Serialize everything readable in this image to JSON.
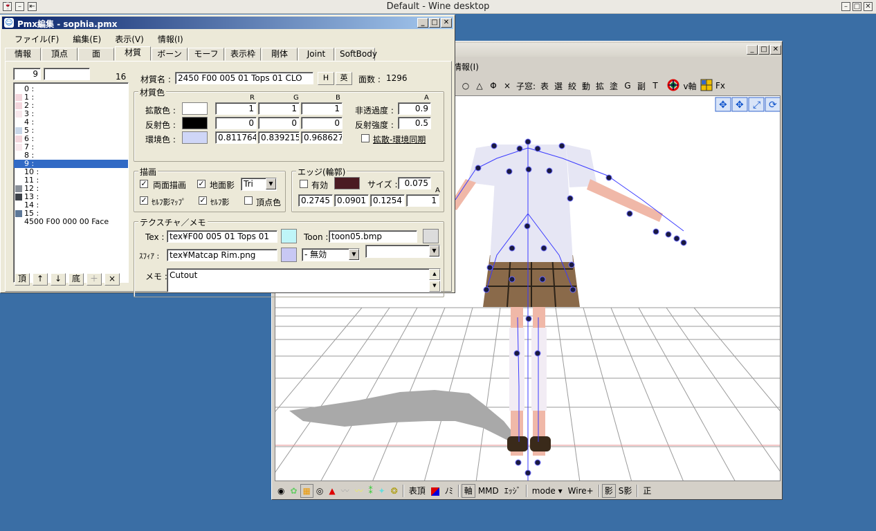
{
  "desktop": {
    "title": "Default - Wine desktop"
  },
  "viewer": {
    "menu_info": "情報(I)",
    "tools": [
      "○",
      "△",
      "Φ",
      "×",
      "子窓:",
      "表",
      "選",
      "絞",
      "動",
      "拡",
      "塗",
      "G",
      "副",
      "T",
      "v軸",
      "Fx"
    ],
    "bottom": [
      "表頂",
      "ﾉﾐ",
      "軸",
      "MMD",
      "ｴｯｼﾞ",
      "mode ▾",
      "Wire+",
      "影",
      "S影",
      "正"
    ]
  },
  "editor": {
    "title": "Pmx編集 - sophia.pmx",
    "menu": [
      "ファイル(F)",
      "編集(E)",
      "表示(V)",
      "情報(I)"
    ],
    "tabs": [
      "情報",
      "頂点",
      "面",
      "材質",
      "ボーン",
      "モーフ",
      "表示枠",
      "剛体",
      "Joint",
      "SoftBody"
    ],
    "active_tab": "材質",
    "list": {
      "index": "9",
      "search": "",
      "count": "16",
      "items": [
        {
          "label": "0 :",
          "color": "#ffffff"
        },
        {
          "label": "1 :",
          "color": "#f3d6dc"
        },
        {
          "label": "2 :",
          "color": "#f3d6dc"
        },
        {
          "label": "3 :",
          "color": "#f8e8ec"
        },
        {
          "label": "4 :",
          "color": "#ffffff"
        },
        {
          "label": "5 :",
          "color": "#c9d7e8"
        },
        {
          "label": "6 :",
          "color": "#f3d6dc"
        },
        {
          "label": "7 :",
          "color": "#f8e8ec"
        },
        {
          "label": "8 :",
          "color": "#ffffff"
        },
        {
          "label": "9 :",
          "color": "#316ac5"
        },
        {
          "label": "10 :",
          "color": "#ffffff"
        },
        {
          "label": "11 :",
          "color": "#ffffff"
        },
        {
          "label": "12 :",
          "color": "#8a9099"
        },
        {
          "label": "13 :",
          "color": "#3c4148"
        },
        {
          "label": "14 :",
          "color": "#ffffff"
        },
        {
          "label": "15 :",
          "color": "#5d7898"
        },
        {
          "label": "4500 F00 000 00 Face",
          "color": "#ffffff"
        }
      ],
      "buttons": [
        "頂",
        "↑",
        "↓",
        "底",
        "＋",
        "×"
      ]
    },
    "material": {
      "name_label": "材質名 :",
      "name_value": "2450 F00 005 01 Tops 01 CLO",
      "h_btn": "H",
      "en_btn": "英",
      "faces_label": "面数 :",
      "faces_value": "1296",
      "color_group": "材質色",
      "col_r": "R",
      "col_g": "G",
      "col_b": "B",
      "col_a": "A",
      "diffuse_label": "拡散色 :",
      "diffuse": [
        "1",
        "1",
        "1"
      ],
      "specular_label": "反射色 :",
      "specular": [
        "0",
        "0",
        "0"
      ],
      "ambient_label": "環境色 :",
      "ambient": [
        "0.811764",
        "0.839215",
        "0.968627"
      ],
      "alpha_label": "非透過度 :",
      "alpha": "0.9",
      "spec_power_label": "反射強度 :",
      "spec_power": "0.5",
      "sync_label": "拡散-環境同期",
      "diffuse_color": "#ffffff",
      "specular_color": "#000000",
      "ambient_color": "#cfd6f7"
    },
    "draw": {
      "group": "描画",
      "double_side": "両面描画",
      "ground_shadow": "地面影",
      "prim": "Tri",
      "self_shadow_map": "ｾﾙﾌ影ﾏｯﾌﾟ",
      "self_shadow": "ｾﾙﾌ影",
      "vertex_color": "頂点色"
    },
    "edge": {
      "group": "エッジ(輪郭)",
      "enabled": "有効",
      "size_label": "サイズ :",
      "size": "0.075",
      "a_label": "A",
      "color": "#4a1a22",
      "rgba": [
        "0.2745",
        "0.0901",
        "0.1254",
        "1"
      ]
    },
    "texture": {
      "group": "テクスチャ／メモ",
      "tex_label": "Tex :",
      "tex_value": "tex¥F00 005 01 Tops 01",
      "tex_color": "#bff5f8",
      "toon_label": "Toon :",
      "toon_value": "toon05.bmp",
      "toon_color": "#dcdcdc",
      "sphere_label": "ｽﾌｨｱ :",
      "sphere_value": "tex¥Matcap Rim.png",
      "sphere_color": "#c8c8f4",
      "sphere_mode": "- 無効",
      "extra_combo": "",
      "memo_label": "メモ :",
      "memo_value": "Cutout"
    }
  }
}
